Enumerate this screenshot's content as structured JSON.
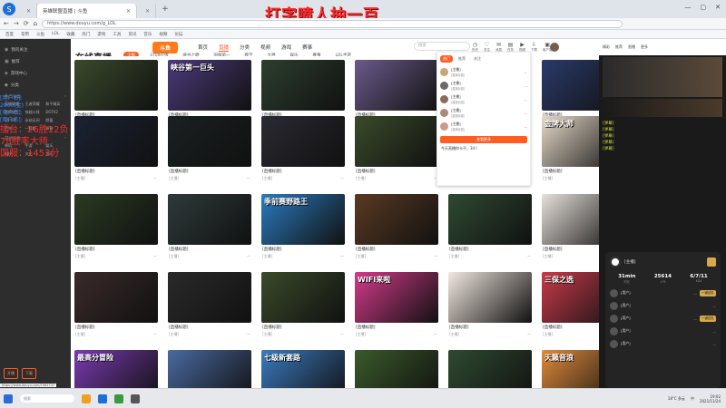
{
  "overlay": {
    "title": "打字喷人抽一百",
    "side_lines_small": [
      "[用户名]:",
      "2000(金)",
      "[用户名]:",
      "[用户名]:"
    ],
    "side_lines_big": [
      "擂台：26胜12负",
      "78胜率大师",
      "国服：1453分"
    ]
  },
  "browser": {
    "tabs": [
      {
        "label": "",
        "active": false
      },
      {
        "label": "英雄联盟直播 | 斗鱼",
        "active": true
      },
      {
        "label": "",
        "active": false
      }
    ],
    "new_tab": "+",
    "controls": [
      "—",
      "▢",
      "✕"
    ],
    "url": "https://www.douyu.com/g_LOL",
    "bookmarks": [
      "百度",
      "常用",
      "斗鱼",
      "LOL",
      "收藏",
      "热门",
      "游戏",
      "工具",
      "资讯",
      "音乐",
      "视频",
      "论坛"
    ]
  },
  "header": {
    "logo": "斗鱼",
    "nav": [
      {
        "label": "首页",
        "active": false
      },
      {
        "label": "直播",
        "active": true
      },
      {
        "label": "分类",
        "active": false
      },
      {
        "label": "视频",
        "active": false
      },
      {
        "label": "游戏",
        "active": false
      },
      {
        "label": "赛事",
        "active": false
      }
    ],
    "search_placeholder": "搜索",
    "icons": [
      {
        "name": "history-icon",
        "sym": "◷",
        "label": "历史"
      },
      {
        "name": "follow-icon",
        "sym": "♡",
        "label": "关注"
      },
      {
        "name": "message-icon",
        "sym": "✉",
        "label": "消息"
      },
      {
        "name": "task-icon",
        "sym": "▤",
        "label": "任务"
      },
      {
        "name": "video-icon",
        "sym": "▶",
        "label": "视频"
      },
      {
        "name": "download-icon",
        "sym": "⇩",
        "label": "下载"
      },
      {
        "name": "app-icon",
        "sym": "▣",
        "label": "客户端"
      }
    ],
    "page_title": "在线直播",
    "filters": [
      {
        "label": "全部",
        "active": true
      },
      {
        "label": "3709在线",
        "active": false
      },
      {
        "label": "峡谷之巅",
        "active": false
      },
      {
        "label": "国服第一",
        "active": false
      },
      {
        "label": "教学",
        "active": false
      },
      {
        "label": "大神",
        "active": false
      },
      {
        "label": "娱乐",
        "active": false
      },
      {
        "label": "赛事",
        "active": false
      },
      {
        "label": "LOL手游",
        "active": false
      }
    ]
  },
  "sidebar": {
    "items": [
      {
        "sym": "◉",
        "label": "我的关注"
      },
      {
        "sym": "▣",
        "label": "推荐"
      },
      {
        "sym": "◈",
        "label": "游戏中心"
      },
      {
        "sym": "◆",
        "label": "分类"
      }
    ],
    "section1": "热门分类",
    "grid1": [
      "英雄联盟",
      "王者荣耀",
      "和平精英",
      "绝地求生",
      "穿越火线",
      "DOTA2",
      "CS:GO",
      "永劫无间",
      "颜值",
      "户外",
      "一起看",
      "原神"
    ],
    "section2": "其他分类",
    "grid2": [
      "单机",
      "手游",
      "娱乐",
      "科技",
      "文化",
      "音乐"
    ],
    "buttons": [
      "开播",
      "下载"
    ]
  },
  "cards": [
    {
      "title": "[直播标题]",
      "streamer": "[主播]",
      "viewers": "—",
      "tag": "",
      "bg": "#3a4a2c"
    },
    {
      "title": "[直播标题]",
      "streamer": "[主播]",
      "viewers": "—",
      "tag": "峡谷第一巨头",
      "bg": "#4c3a7a"
    },
    {
      "title": "[直播标题]",
      "streamer": "[主播]",
      "viewers": "—",
      "tag": "",
      "bg": "#2c3e2e"
    },
    {
      "title": "[直播标题]",
      "streamer": "[主播]",
      "viewers": "—",
      "tag": "",
      "bg": "#6a5a8a"
    },
    {
      "title": "[直播标题]",
      "streamer": "[主播]",
      "viewers": "—",
      "tag": "",
      "bg": "#2a3a6a"
    },
    {
      "title": "[直播标题]",
      "streamer": "[主播]",
      "viewers": "—",
      "tag": "",
      "bg": "#1a2232"
    },
    {
      "title": "[直播标题]",
      "streamer": "[主播]",
      "viewers": "—",
      "tag": "",
      "bg": "#1a2020"
    },
    {
      "title": "[直播标题]",
      "streamer": "[主播]",
      "viewers": "—",
      "tag": "",
      "bg": "#2a2a32"
    },
    {
      "title": "[直播标题]",
      "streamer": "[主播]",
      "viewers": "—",
      "tag": "",
      "bg": "#3a4a2a"
    },
    {
      "title": "[直播标题]",
      "streamer": "[主播]",
      "viewers": "—",
      "tag": "金牌大师",
      "bg": "#e6d9c8"
    },
    {
      "title": "[直播标题]",
      "streamer": "[主播]",
      "viewers": "—",
      "tag": "",
      "bg": "#2a3a22"
    },
    {
      "title": "[直播标题]",
      "streamer": "[主播]",
      "viewers": "—",
      "tag": "",
      "bg": "#2e3a3a"
    },
    {
      "title": "[直播标题]",
      "streamer": "[主播]",
      "viewers": "—",
      "tag": "季前赛野路王",
      "bg": "#2a7abf"
    },
    {
      "title": "[直播标题]",
      "streamer": "[主播]",
      "viewers": "—",
      "tag": "",
      "bg": "#5a3a22"
    },
    {
      "title": "[直播标题]",
      "streamer": "[主播]",
      "viewers": "—",
      "tag": "",
      "bg": "#2e4a32"
    },
    {
      "title": "[直播标题]",
      "streamer": "[主播]",
      "viewers": "—",
      "tag": "",
      "bg": "#e6e0da"
    },
    {
      "title": "[直播标题]",
      "streamer": "[主播]",
      "viewers": "—",
      "tag": "",
      "bg": "#3a2a2a"
    },
    {
      "title": "[直播标题]",
      "streamer": "[主播]",
      "viewers": "—",
      "tag": "",
      "bg": "#2a2a2a"
    },
    {
      "title": "[直播标题]",
      "streamer": "[主播]",
      "viewers": "—",
      "tag": "",
      "bg": "#3a4a2a"
    },
    {
      "title": "[直播标题]",
      "streamer": "[主播]",
      "viewers": "—",
      "tag": "WIFI来啦",
      "bg": "#d23a8a"
    },
    {
      "title": "[直播标题]",
      "streamer": "[主播]",
      "viewers": "—",
      "tag": "",
      "bg": "#f2e8e0"
    },
    {
      "title": "[直播标题]",
      "streamer": "[主播]",
      "viewers": "—",
      "tag": "三保之选",
      "bg": "#c73a4a"
    },
    {
      "title": "[直播标题]",
      "streamer": "[主播]",
      "viewers": "—",
      "tag": "最高分冒险",
      "bg": "#7a3ab0"
    },
    {
      "title": "[直播标题]",
      "streamer": "[主播]",
      "viewers": "—",
      "tag": "",
      "bg": "#4a6aa0"
    },
    {
      "title": "[直播标题]",
      "streamer": "[主播]",
      "viewers": "—",
      "tag": "七级新套路",
      "bg": "#3a7ac0"
    },
    {
      "title": "[直播标题]",
      "streamer": "[主播]",
      "viewers": "—",
      "tag": "",
      "bg": "#3a5a2a"
    },
    {
      "title": "[直播标题]",
      "streamer": "[主播]",
      "viewers": "—",
      "tag": "",
      "bg": "#2e4a30"
    },
    {
      "title": "[直播标题]",
      "streamer": "[主播]",
      "viewers": "—",
      "tag": "天籁音浪",
      "bg": "#e08a3a"
    },
    {
      "title": "[直播标题]",
      "streamer": "[主播]",
      "viewers": "—",
      "tag": "",
      "bg": "#2a3a3a"
    }
  ],
  "hot_panel": {
    "tabs": [
      {
        "label": "热门",
        "active": true
      },
      {
        "label": "推荐",
        "active": false
      },
      {
        "label": "关注",
        "active": false
      }
    ],
    "rows": [
      {
        "title": "[主播]",
        "sub": "[直播标题]",
        "num": "—",
        "color": "#c7a47a"
      },
      {
        "title": "[主播]",
        "sub": "[直播标题]",
        "num": "—",
        "color": "#6a6a6a"
      },
      {
        "title": "[主播]",
        "sub": "[直播标题]",
        "num": "—",
        "color": "#8a6a5a"
      },
      {
        "title": "[主播]",
        "sub": "[直播标题]",
        "num": "—",
        "color": "#aa8a7a"
      },
      {
        "title": "[主播]",
        "sub": "[直播标题]",
        "num": "—",
        "color": "#cc9a88"
      }
    ],
    "button": "查看更多",
    "footer": "今天直播你卡不，34 I"
  },
  "right_strip": {
    "header": [
      "精彩",
      "推荐",
      "直播",
      "更多"
    ],
    "chat": [
      "[弹幕]",
      "[弹幕]",
      "[弹幕]",
      "[弹幕]",
      "[弹幕]"
    ]
  },
  "rank": {
    "name": "[主播]",
    "stats": [
      {
        "val": "31min",
        "lab": "时长"
      },
      {
        "val": "25614",
        "lab": "人气"
      },
      {
        "val": "6/7/11",
        "lab": "KDA"
      }
    ],
    "rows": [
      {
        "name": "[用户]",
        "score": "—",
        "btn": "一键送礼"
      },
      {
        "name": "[用户]",
        "score": "—",
        "btn": ""
      },
      {
        "name": "[用户]",
        "score": "—",
        "btn": "一键送礼"
      },
      {
        "name": "[用户]",
        "score": "—",
        "btn": ""
      },
      {
        "name": "[用户]",
        "score": "—",
        "btn": ""
      }
    ]
  },
  "taskbar": {
    "status_url": "https://www.douyu.com/1985747",
    "search_placeholder": "搜索",
    "weather": "18°C 多云",
    "time": "19:02",
    "date": "2021/11/24",
    "lang": "中"
  }
}
